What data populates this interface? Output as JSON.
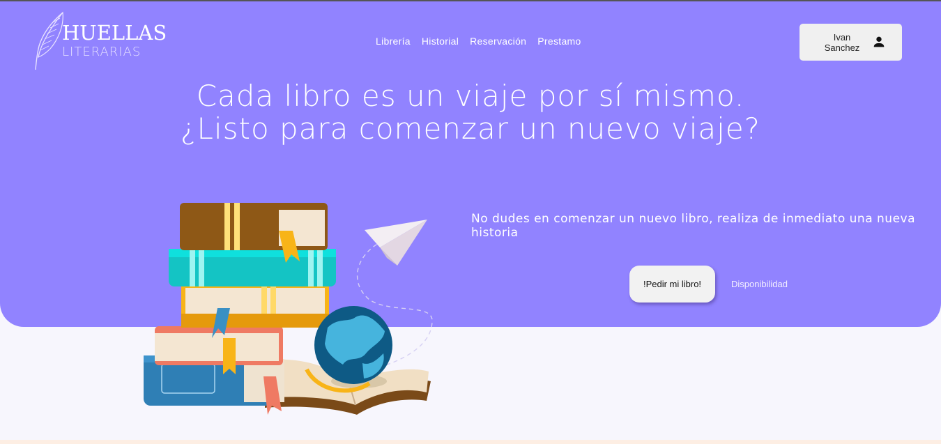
{
  "brand": {
    "top": "HUELLAS",
    "bottom": "LITERARIAS"
  },
  "nav": {
    "items": [
      {
        "label": "Librería"
      },
      {
        "label": "Historial"
      },
      {
        "label": "Reservación"
      },
      {
        "label": "Prestamo"
      }
    ]
  },
  "user": {
    "name": "Ivan Sanchez",
    "icon": "person-icon"
  },
  "hero": {
    "headline_line1": "Cada libro es un viaje por sí mismo.",
    "headline_line2": "¿Listo para comenzar un nuevo viaje?",
    "subtext": "No dudes en comenzar un nuevo libro, realiza de inmediato una nueva historia",
    "cta_label": "!Pedir mi libro!",
    "secondary_label": "Disponibilidad"
  },
  "colors": {
    "hero_bg": "#9183ff",
    "page_bg": "#f7f6fd",
    "button_bg": "#f2f2f2"
  }
}
